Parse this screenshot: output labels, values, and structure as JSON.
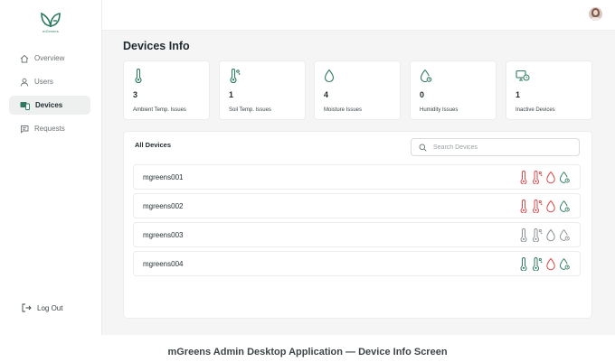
{
  "brand": {
    "name": "mGreens",
    "color": "#2f7a5e"
  },
  "sidebar": {
    "items": [
      {
        "label": "Overview",
        "icon": "home-icon",
        "active": false
      },
      {
        "label": "Users",
        "icon": "user-icon",
        "active": false
      },
      {
        "label": "Devices",
        "icon": "devices-icon",
        "active": true
      },
      {
        "label": "Requests",
        "icon": "message-icon",
        "active": false
      }
    ],
    "logout_label": "Log Out"
  },
  "page": {
    "title": "Devices Info"
  },
  "summary_cards": [
    {
      "count": "3",
      "label": "Ambient Temp. Issues",
      "icon": "thermometer-icon"
    },
    {
      "count": "1",
      "label": "Soil Temp. Issues",
      "icon": "soil-thermometer-icon"
    },
    {
      "count": "4",
      "label": "Moisture Issues",
      "icon": "droplet-icon"
    },
    {
      "count": "0",
      "label": "Humidity Issues",
      "icon": "humidity-icon"
    },
    {
      "count": "1",
      "label": "Inactive Devices",
      "icon": "inactive-device-icon"
    }
  ],
  "devices_panel": {
    "title": "All Devices",
    "search_placeholder": "Search Devices"
  },
  "devices": [
    {
      "name": "mgreens001",
      "status": [
        "red",
        "red",
        "red",
        "green"
      ]
    },
    {
      "name": "mgreens002",
      "status": [
        "red",
        "red",
        "red",
        "green"
      ]
    },
    {
      "name": "mgreens003",
      "status": [
        "gray",
        "gray",
        "gray",
        "gray"
      ]
    },
    {
      "name": "mgreens004",
      "status": [
        "green",
        "green",
        "red",
        "green"
      ]
    }
  ],
  "colors": {
    "ok": "#2f7a5e",
    "issue": "#d84a4a",
    "inactive": "#8a9295",
    "accent": "#2f7a5e"
  },
  "caption": "mGreens Admin Desktop Application — Device Info Screen"
}
